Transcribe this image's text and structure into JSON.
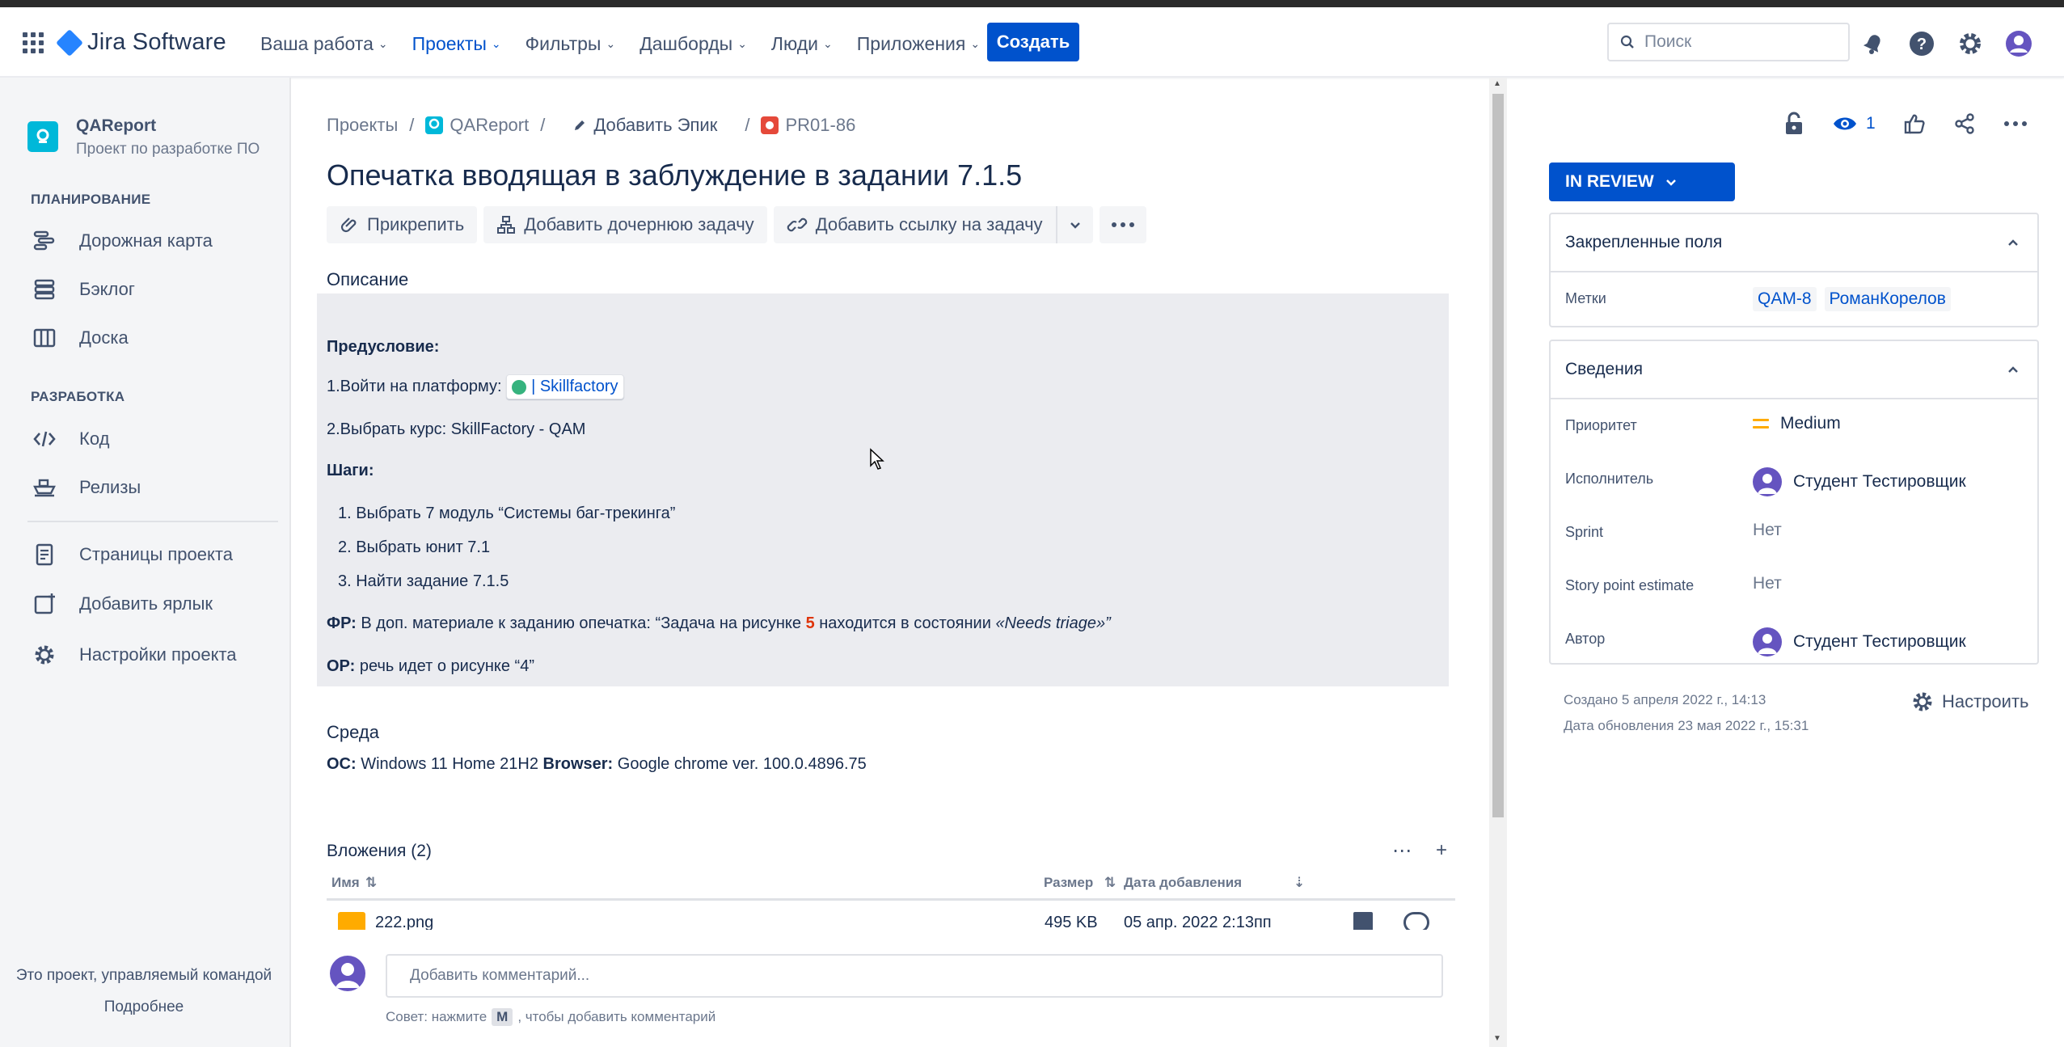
{
  "topnav": {
    "product": "Jira Software",
    "items": [
      "Ваша работа",
      "Проекты",
      "Фильтры",
      "Дашборды",
      "Люди",
      "Приложения"
    ],
    "create_label": "Создать",
    "search_placeholder": "Поиск"
  },
  "sidebar": {
    "project_name": "QAReport",
    "project_type": "Проект по разработке ПО",
    "planning_label": "ПЛАНИРОВАНИЕ",
    "planning_items": [
      "Дорожная карта",
      "Бэклог",
      "Доска"
    ],
    "dev_label": "РАЗРАБОТКА",
    "dev_items": [
      "Код",
      "Релизы"
    ],
    "extra_items": [
      "Страницы проекта",
      "Добавить ярлык",
      "Настройки проекта"
    ],
    "footer_text": "Это проект, управляемый командой",
    "footer_link": "Подробнее"
  },
  "issue": {
    "breadcrumbs": {
      "projects": "Проекты",
      "project": "QAReport",
      "epic": "Добавить Эпик",
      "key": "PR01-86"
    },
    "title": "Опечатка вводящая в заблуждение в задании 7.1.5",
    "actions": {
      "attach": "Прикрепить",
      "child": "Добавить дочернюю задачу",
      "link": "Добавить ссылку на задачу"
    },
    "description_label": "Описание",
    "description": {
      "precondition": "Предусловие:",
      "step1_prefix": "1.Войти на платформу:",
      "smartlink": "| Skillfactory",
      "step2": "2.Выбрать курс: SkillFactory - QAM",
      "steps_label": "Шаги:",
      "list": [
        "1. Выбрать 7 модуль “Системы баг-трекинга”",
        "2. Выбрать юнит 7.1",
        "3. Найти задание 7.1.5"
      ],
      "fr_label": "ФР:",
      "fr_text1": "В доп. материале к заданию опечатка:  “Задача на рисунке",
      "fr_num": "5",
      "fr_text2": "находится в состоянии",
      "fr_italic": "«Needs triage»”",
      "or_label": "ОР:",
      "or_text": "речь идет о рисунке “4”"
    },
    "environment_label": "Среда",
    "environment": {
      "os_label": "ОС:",
      "os_value": "Windows 11 Home 21H2",
      "browser_label": "Browser:",
      "browser_value": "Google chrome ver. 100.0.4896.75"
    },
    "attachments": {
      "title": "Вложения (2)",
      "columns": [
        "Имя",
        "Размер",
        "Дата добавления"
      ],
      "rows": [
        {
          "name": "222.png",
          "size": "495 KB",
          "date": "05 апр. 2022 2:13пп"
        }
      ]
    },
    "comment_placeholder": "Добавить комментарий...",
    "comment_tip_prefix": "Совет: нажмите",
    "comment_tip_key": "M",
    "comment_tip_suffix": ", чтобы добавить комментарий"
  },
  "details": {
    "watchers": "1",
    "status": "IN REVIEW",
    "pinned_title": "Закрепленные поля",
    "labels_label": "Метки",
    "labels": [
      "QAM-8",
      "РоманКорелов"
    ],
    "info_title": "Сведения",
    "priority_label": "Приоритет",
    "priority_value": "Medium",
    "assignee_label": "Исполнитель",
    "assignee_value": "Студент Тестировщик",
    "sprint_label": "Sprint",
    "sprint_value": "Нет",
    "sp_label": "Story point estimate",
    "sp_value": "Нет",
    "author_label": "Автор",
    "author_value": "Студент Тестировщик",
    "created": "Создано 5 апреля 2022 г., 14:13",
    "updated": "Дата обновления 23 мая 2022 г., 15:31",
    "configure": "Настроить"
  },
  "colors": {
    "brand": "#0052cc",
    "text": "#172b4d",
    "muted": "#6b778c",
    "highlight_red": "#de350b",
    "priority_medium": "#ffab00"
  }
}
